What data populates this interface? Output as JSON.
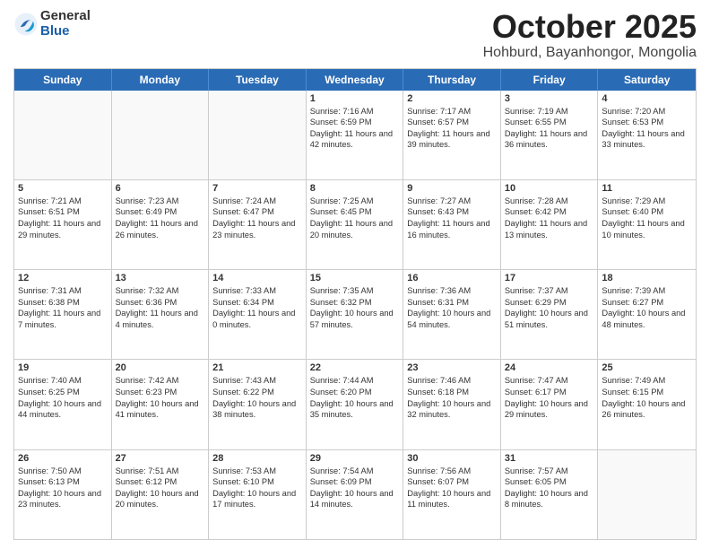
{
  "logo": {
    "general": "General",
    "blue": "Blue"
  },
  "header": {
    "month": "October 2025",
    "location": "Hohburd, Bayanhongor, Mongolia"
  },
  "days": [
    "Sunday",
    "Monday",
    "Tuesday",
    "Wednesday",
    "Thursday",
    "Friday",
    "Saturday"
  ],
  "weeks": [
    [
      {
        "day": "",
        "empty": true
      },
      {
        "day": "",
        "empty": true
      },
      {
        "day": "",
        "empty": true
      },
      {
        "day": "1",
        "sunrise": "Sunrise: 7:16 AM",
        "sunset": "Sunset: 6:59 PM",
        "daylight": "Daylight: 11 hours and 42 minutes."
      },
      {
        "day": "2",
        "sunrise": "Sunrise: 7:17 AM",
        "sunset": "Sunset: 6:57 PM",
        "daylight": "Daylight: 11 hours and 39 minutes."
      },
      {
        "day": "3",
        "sunrise": "Sunrise: 7:19 AM",
        "sunset": "Sunset: 6:55 PM",
        "daylight": "Daylight: 11 hours and 36 minutes."
      },
      {
        "day": "4",
        "sunrise": "Sunrise: 7:20 AM",
        "sunset": "Sunset: 6:53 PM",
        "daylight": "Daylight: 11 hours and 33 minutes."
      }
    ],
    [
      {
        "day": "5",
        "sunrise": "Sunrise: 7:21 AM",
        "sunset": "Sunset: 6:51 PM",
        "daylight": "Daylight: 11 hours and 29 minutes."
      },
      {
        "day": "6",
        "sunrise": "Sunrise: 7:23 AM",
        "sunset": "Sunset: 6:49 PM",
        "daylight": "Daylight: 11 hours and 26 minutes."
      },
      {
        "day": "7",
        "sunrise": "Sunrise: 7:24 AM",
        "sunset": "Sunset: 6:47 PM",
        "daylight": "Daylight: 11 hours and 23 minutes."
      },
      {
        "day": "8",
        "sunrise": "Sunrise: 7:25 AM",
        "sunset": "Sunset: 6:45 PM",
        "daylight": "Daylight: 11 hours and 20 minutes."
      },
      {
        "day": "9",
        "sunrise": "Sunrise: 7:27 AM",
        "sunset": "Sunset: 6:43 PM",
        "daylight": "Daylight: 11 hours and 16 minutes."
      },
      {
        "day": "10",
        "sunrise": "Sunrise: 7:28 AM",
        "sunset": "Sunset: 6:42 PM",
        "daylight": "Daylight: 11 hours and 13 minutes."
      },
      {
        "day": "11",
        "sunrise": "Sunrise: 7:29 AM",
        "sunset": "Sunset: 6:40 PM",
        "daylight": "Daylight: 11 hours and 10 minutes."
      }
    ],
    [
      {
        "day": "12",
        "sunrise": "Sunrise: 7:31 AM",
        "sunset": "Sunset: 6:38 PM",
        "daylight": "Daylight: 11 hours and 7 minutes."
      },
      {
        "day": "13",
        "sunrise": "Sunrise: 7:32 AM",
        "sunset": "Sunset: 6:36 PM",
        "daylight": "Daylight: 11 hours and 4 minutes."
      },
      {
        "day": "14",
        "sunrise": "Sunrise: 7:33 AM",
        "sunset": "Sunset: 6:34 PM",
        "daylight": "Daylight: 11 hours and 0 minutes."
      },
      {
        "day": "15",
        "sunrise": "Sunrise: 7:35 AM",
        "sunset": "Sunset: 6:32 PM",
        "daylight": "Daylight: 10 hours and 57 minutes."
      },
      {
        "day": "16",
        "sunrise": "Sunrise: 7:36 AM",
        "sunset": "Sunset: 6:31 PM",
        "daylight": "Daylight: 10 hours and 54 minutes."
      },
      {
        "day": "17",
        "sunrise": "Sunrise: 7:37 AM",
        "sunset": "Sunset: 6:29 PM",
        "daylight": "Daylight: 10 hours and 51 minutes."
      },
      {
        "day": "18",
        "sunrise": "Sunrise: 7:39 AM",
        "sunset": "Sunset: 6:27 PM",
        "daylight": "Daylight: 10 hours and 48 minutes."
      }
    ],
    [
      {
        "day": "19",
        "sunrise": "Sunrise: 7:40 AM",
        "sunset": "Sunset: 6:25 PM",
        "daylight": "Daylight: 10 hours and 44 minutes."
      },
      {
        "day": "20",
        "sunrise": "Sunrise: 7:42 AM",
        "sunset": "Sunset: 6:23 PM",
        "daylight": "Daylight: 10 hours and 41 minutes."
      },
      {
        "day": "21",
        "sunrise": "Sunrise: 7:43 AM",
        "sunset": "Sunset: 6:22 PM",
        "daylight": "Daylight: 10 hours and 38 minutes."
      },
      {
        "day": "22",
        "sunrise": "Sunrise: 7:44 AM",
        "sunset": "Sunset: 6:20 PM",
        "daylight": "Daylight: 10 hours and 35 minutes."
      },
      {
        "day": "23",
        "sunrise": "Sunrise: 7:46 AM",
        "sunset": "Sunset: 6:18 PM",
        "daylight": "Daylight: 10 hours and 32 minutes."
      },
      {
        "day": "24",
        "sunrise": "Sunrise: 7:47 AM",
        "sunset": "Sunset: 6:17 PM",
        "daylight": "Daylight: 10 hours and 29 minutes."
      },
      {
        "day": "25",
        "sunrise": "Sunrise: 7:49 AM",
        "sunset": "Sunset: 6:15 PM",
        "daylight": "Daylight: 10 hours and 26 minutes."
      }
    ],
    [
      {
        "day": "26",
        "sunrise": "Sunrise: 7:50 AM",
        "sunset": "Sunset: 6:13 PM",
        "daylight": "Daylight: 10 hours and 23 minutes."
      },
      {
        "day": "27",
        "sunrise": "Sunrise: 7:51 AM",
        "sunset": "Sunset: 6:12 PM",
        "daylight": "Daylight: 10 hours and 20 minutes."
      },
      {
        "day": "28",
        "sunrise": "Sunrise: 7:53 AM",
        "sunset": "Sunset: 6:10 PM",
        "daylight": "Daylight: 10 hours and 17 minutes."
      },
      {
        "day": "29",
        "sunrise": "Sunrise: 7:54 AM",
        "sunset": "Sunset: 6:09 PM",
        "daylight": "Daylight: 10 hours and 14 minutes."
      },
      {
        "day": "30",
        "sunrise": "Sunrise: 7:56 AM",
        "sunset": "Sunset: 6:07 PM",
        "daylight": "Daylight: 10 hours and 11 minutes."
      },
      {
        "day": "31",
        "sunrise": "Sunrise: 7:57 AM",
        "sunset": "Sunset: 6:05 PM",
        "daylight": "Daylight: 10 hours and 8 minutes."
      },
      {
        "day": "",
        "empty": true
      }
    ]
  ]
}
